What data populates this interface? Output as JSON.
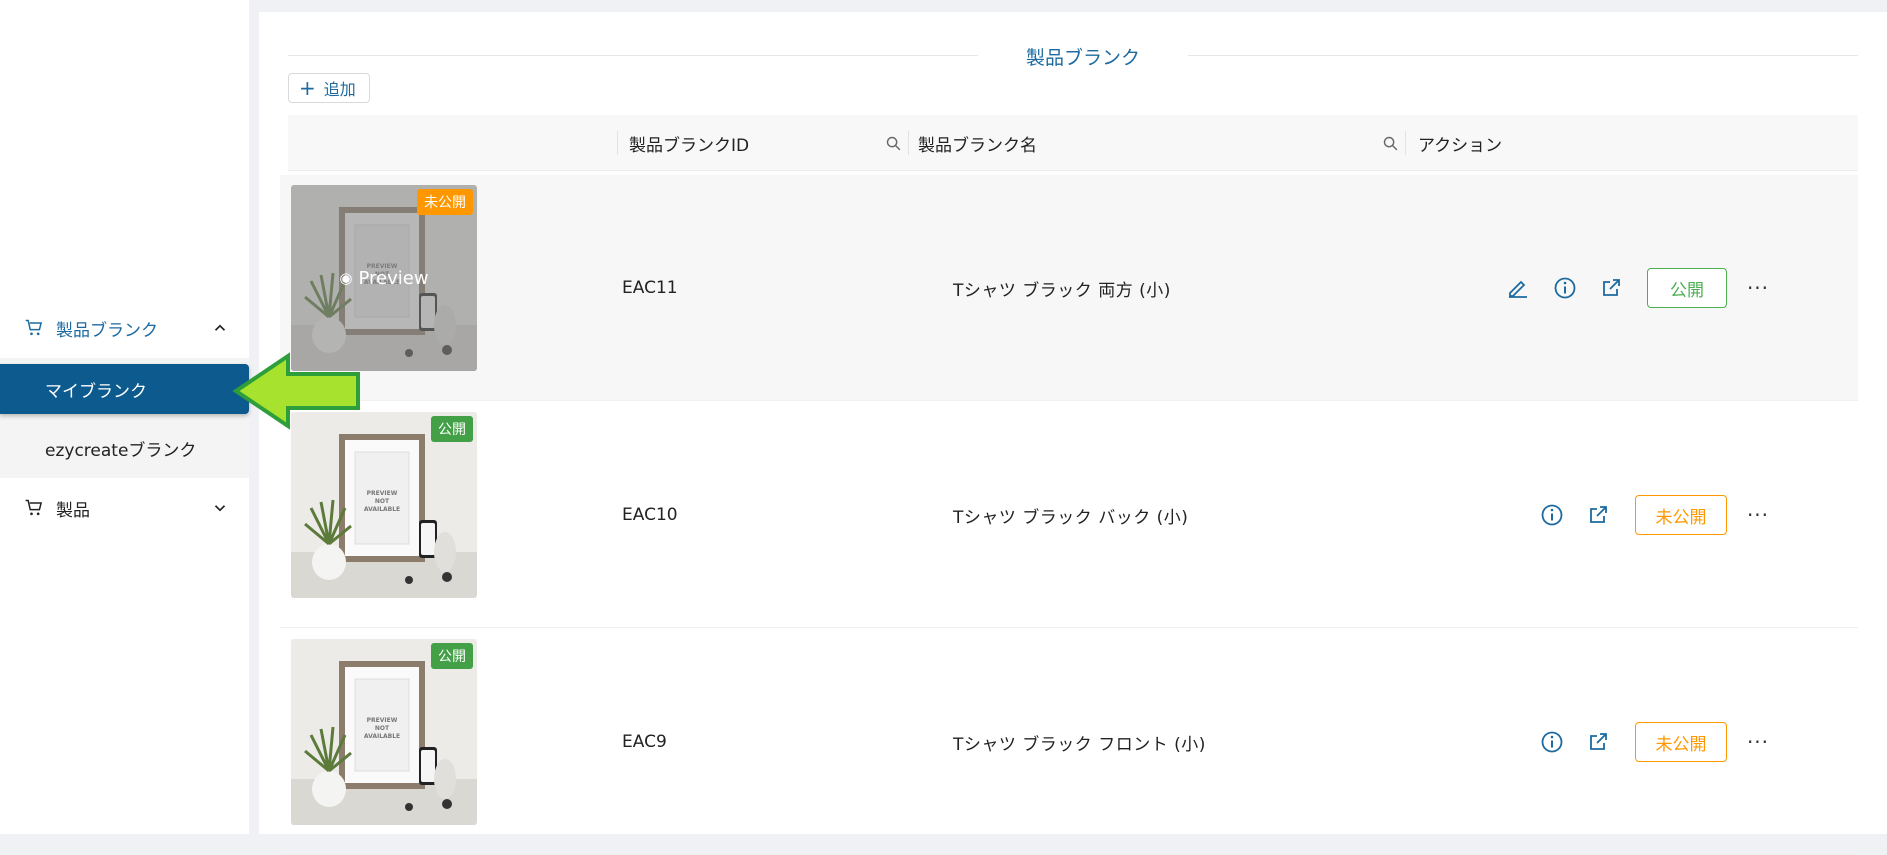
{
  "sidebar": {
    "groups": [
      {
        "label": "製品ブランク",
        "expanded": true,
        "icon": "cart-icon"
      },
      {
        "label": "製品",
        "expanded": false,
        "icon": "cart-icon"
      }
    ],
    "sub_items": [
      {
        "label": "マイブランク",
        "active": true
      },
      {
        "label": "ezycreateブランク",
        "active": false
      }
    ]
  },
  "main": {
    "title": "製品ブランク",
    "add_label": "追加",
    "columns": {
      "id": "製品ブランクID",
      "name": "製品ブランク名",
      "actions": "アクション"
    },
    "rows": [
      {
        "id": "EAC11",
        "name": "Tシャツ ブラック 両方 (小)",
        "status_badge": "未公開",
        "action_button": "公開",
        "preview_label": "Preview",
        "thumb_text": "PREVIEW NOT AVAILABLE"
      },
      {
        "id": "EAC10",
        "name": "Tシャツ ブラック バック (小)",
        "status_badge": "公開",
        "action_button": "未公開",
        "thumb_text": "PREVIEW NOT AVAILABLE"
      },
      {
        "id": "EAC9",
        "name": "Tシャツ ブラック フロント (小)",
        "status_badge": "公開",
        "action_button": "未公開",
        "thumb_text": "PREVIEW NOT AVAILABLE"
      }
    ]
  },
  "colors": {
    "primary": "#1c6aa0",
    "active_nav": "#0c5a8e",
    "published": "#43a047",
    "unpublished": "#ff9800",
    "arrow": "#a6e22e"
  }
}
